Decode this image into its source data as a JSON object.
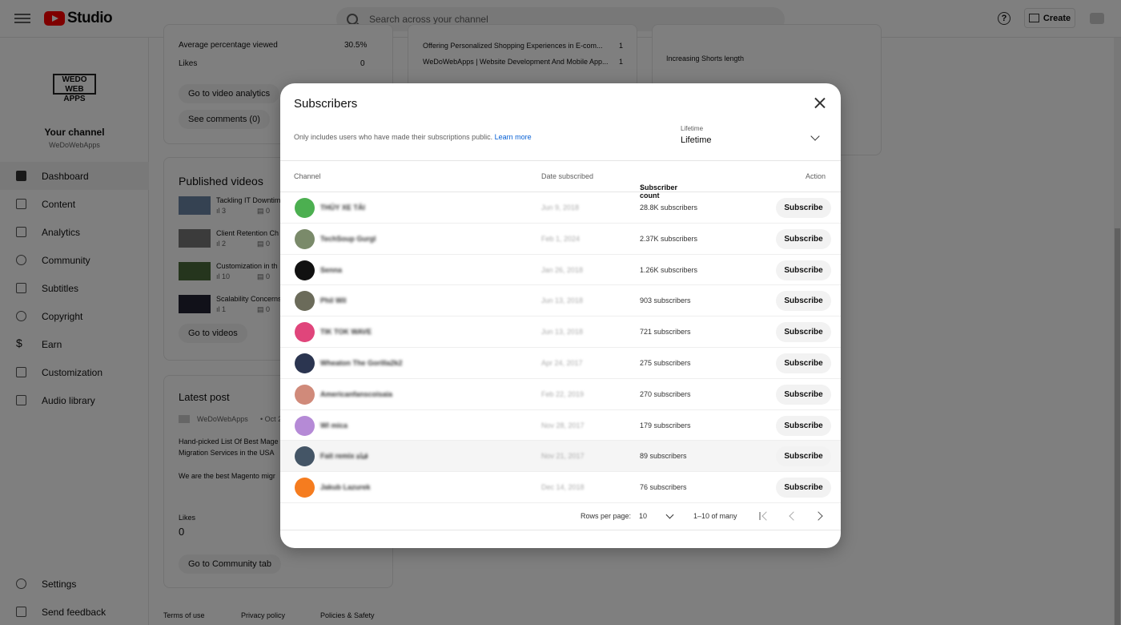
{
  "app": {
    "name": "Studio"
  },
  "search": {
    "placeholder": "Search across your channel"
  },
  "header": {
    "create_label": "Create",
    "help_glyph": "?"
  },
  "channel": {
    "logo_text": "WEDO WEB APPS",
    "title": "Your channel",
    "name": "WeDoWebApps"
  },
  "sidebar": {
    "items": [
      {
        "label": "Dashboard",
        "icon": "dashboard-icon"
      },
      {
        "label": "Content",
        "icon": "content-icon"
      },
      {
        "label": "Analytics",
        "icon": "analytics-icon"
      },
      {
        "label": "Community",
        "icon": "community-icon"
      },
      {
        "label": "Subtitles",
        "icon": "subtitles-icon"
      },
      {
        "label": "Copyright",
        "icon": "copyright-icon"
      },
      {
        "label": "Earn",
        "icon": "earn-icon"
      },
      {
        "label": "Customization",
        "icon": "customization-icon"
      },
      {
        "label": "Audio library",
        "icon": "audio-library-icon"
      }
    ],
    "bottom": [
      {
        "label": "Settings",
        "icon": "gear-icon"
      },
      {
        "label": "Send feedback",
        "icon": "feedback-icon"
      }
    ]
  },
  "background": {
    "stats": [
      {
        "label": "Average percentage viewed",
        "value": "30.5%"
      },
      {
        "label": "Likes",
        "value": "0"
      }
    ],
    "btn_analytics": "Go to video analytics",
    "btn_comments": "See comments (0)",
    "published_title": "Published videos",
    "videos": [
      {
        "title": "Tackling IT Downtim",
        "views": "3",
        "comments": "0"
      },
      {
        "title": "Client Retention Ch",
        "views": "2",
        "comments": "0"
      },
      {
        "title": "Customization in th",
        "views": "10",
        "comments": "0"
      },
      {
        "title": "Scalability Concerns",
        "views": "1",
        "comments": "0"
      }
    ],
    "btn_videos": "Go to videos",
    "latest_post_title": "Latest post",
    "post_author": "WeDoWebApps",
    "post_date": "• Oct 2",
    "post_text1": "Hand-picked List Of Best Mage",
    "post_text2": "Migration Services in the USA",
    "post_text3": "We are the best Magento migr",
    "likes_label": "Likes",
    "likes_value": "0",
    "btn_community": "Go to Community tab",
    "top_content": [
      {
        "title": "Offering Personalized Shopping Experiences in E-com...",
        "value": "1"
      },
      {
        "title": "WeDoWebApps | Website Development And Mobile App...",
        "value": "1"
      }
    ],
    "idea": "Increasing Shorts length",
    "footer": [
      "Terms of use",
      "Privacy policy",
      "Policies & Safety"
    ]
  },
  "modal": {
    "title": "Subscribers",
    "note": "Only includes users who have made their subscriptions public.",
    "learn_more": "Learn more",
    "period_label": "Lifetime",
    "period_value": "Lifetime",
    "columns": {
      "channel": "Channel",
      "date": "Date subscribed",
      "count": "Subscriber count",
      "action": "Action"
    },
    "rows": [
      {
        "name": "THỦY XE TẢI",
        "date": "Jun 9, 2018",
        "count": "28.8K subscribers",
        "color": "#4caf50"
      },
      {
        "name": "TechSoup Gurgl",
        "date": "Feb 1, 2024",
        "count": "2.37K subscribers",
        "color": "#7a8a6a"
      },
      {
        "name": "Senna",
        "date": "Jan 26, 2018",
        "count": "1.26K subscribers",
        "color": "#111111"
      },
      {
        "name": "Phil Wil",
        "date": "Jun 13, 2018",
        "count": "903 subscribers",
        "color": "#6b6b5a"
      },
      {
        "name": "TIK TOK WAVE",
        "date": "Jun 13, 2018",
        "count": "721 subscribers",
        "color": "#e0457b"
      },
      {
        "name": "Wheaton The Gorilla2k2",
        "date": "Apr 24, 2017",
        "count": "275 subscribers",
        "color": "#2b3550"
      },
      {
        "name": "Americanfanscoisaia",
        "date": "Feb 22, 2019",
        "count": "270 subscribers",
        "color": "#d08a7a"
      },
      {
        "name": "Wl mica",
        "date": "Nov 28, 2017",
        "count": "179 subscribers",
        "color": "#b58ad6"
      },
      {
        "name": "Fait remix قناة",
        "date": "Nov 21, 2017",
        "count": "89 subscribers",
        "color": "#445566"
      },
      {
        "name": "Jakub Lazurek",
        "date": "Dec 14, 2018",
        "count": "76 subscribers",
        "color": "#f57c1f"
      }
    ],
    "subscribe_label": "Subscribe",
    "rows_per_page_label": "Rows per page:",
    "rows_per_page": "10",
    "range": "1–10 of many"
  }
}
